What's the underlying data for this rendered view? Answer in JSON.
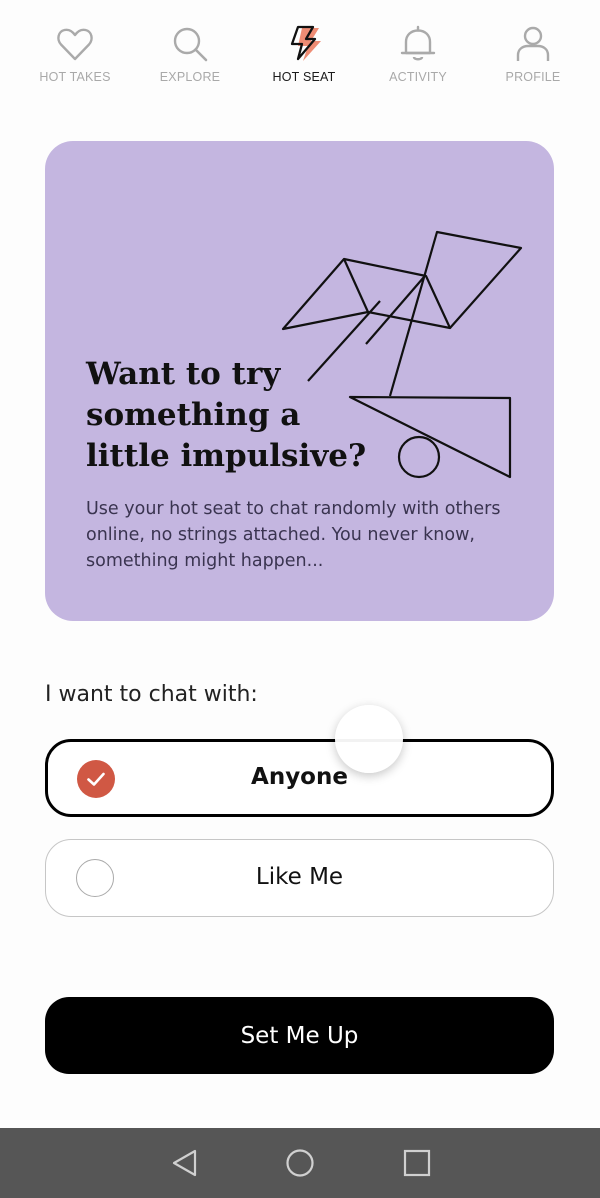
{
  "nav": {
    "items": [
      {
        "label": "HOT TAKES",
        "icon": "heart-icon"
      },
      {
        "label": "EXPLORE",
        "icon": "search-icon"
      },
      {
        "label": "HOT SEAT",
        "icon": "lightning-bolt-icon",
        "active": true
      },
      {
        "label": "ACTIVITY",
        "icon": "bell-icon"
      },
      {
        "label": "PROFILE",
        "icon": "person-icon"
      }
    ]
  },
  "card": {
    "title": "Want to try something a little impulsive?",
    "description": "Use your hot seat to chat randomly with others online, no strings attached. You never know, something might happen...",
    "background": "#c4b6e0"
  },
  "chat": {
    "label": "I want to chat with:",
    "options": [
      {
        "label": "Anyone",
        "selected": true
      },
      {
        "label": "Like Me",
        "selected": false
      }
    ],
    "accent": "#d05844"
  },
  "cta": {
    "label": "Set Me Up"
  },
  "system_nav": {
    "back": "back-triangle-icon",
    "home": "home-circle-icon",
    "recents": "recents-square-icon"
  }
}
